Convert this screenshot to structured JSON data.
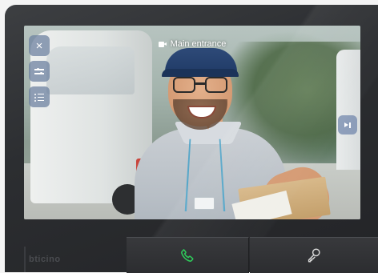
{
  "screen": {
    "title": "Main entrance",
    "title_icon": "video-camera-icon"
  },
  "controls": {
    "close_icon": "×",
    "adjust_icon": "sliders-icon",
    "menu_icon": "list-icon",
    "playback_icon": "play-pause-icon"
  },
  "device": {
    "brand": "bticino"
  },
  "softkeys": {
    "answer_icon": "phone-icon",
    "answer_color": "#2ecc5a",
    "door_icon": "key-icon"
  }
}
